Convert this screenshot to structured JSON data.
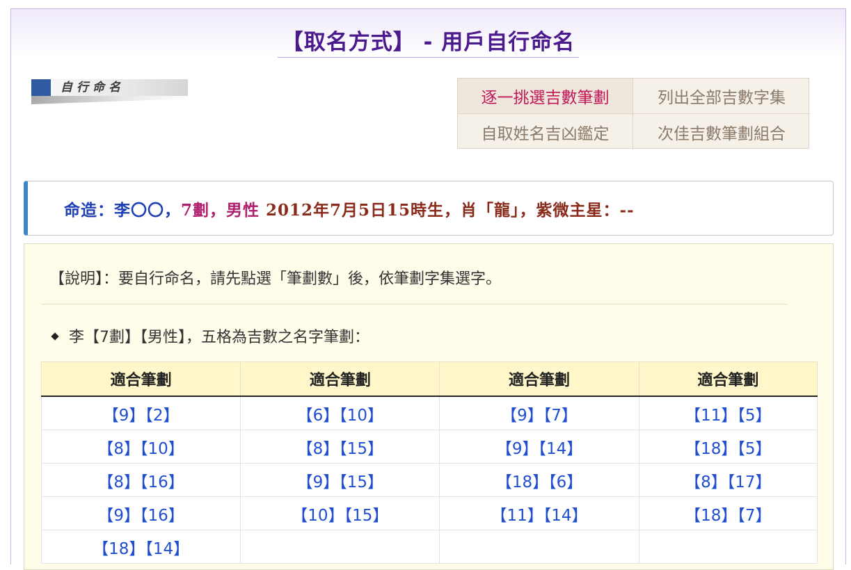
{
  "page": {
    "title": "【取名方式】 - 用戶自行命名"
  },
  "side_banner": {
    "label": "自行命名"
  },
  "tabs": [
    {
      "label": "逐一挑選吉數筆劃",
      "active": true
    },
    {
      "label": "列出全部吉數字集",
      "active": false
    },
    {
      "label": "自取姓名吉凶鑑定",
      "active": false
    },
    {
      "label": "次佳吉數筆劃組合",
      "active": false
    }
  ],
  "destiny": {
    "part1": "命造：李〇〇，",
    "part2": "7劃，男性",
    "part3": " 2012年7月5日15時生，肖「龍」，紫微主星：--"
  },
  "panel": {
    "description": "【說明】：要自行命名，請先點選「筆劃數」後，依筆劃字集選字。",
    "subtitle": "李【7劃】【男性】，五格為吉數之名字筆劃：",
    "column_headers": [
      "適合筆劃",
      "適合筆劃",
      "適合筆劃",
      "適合筆劃"
    ],
    "rows": [
      [
        "【9】【2】",
        "【6】【10】",
        "【9】【7】",
        "【11】【5】"
      ],
      [
        "【8】【10】",
        "【8】【15】",
        "【9】【14】",
        "【18】【5】"
      ],
      [
        "【8】【16】",
        "【9】【15】",
        "【18】【6】",
        "【8】【17】"
      ],
      [
        "【9】【16】",
        "【10】【15】",
        "【11】【14】",
        "【18】【7】"
      ],
      [
        "【18】【14】",
        "",
        "",
        ""
      ]
    ]
  },
  "colors": {
    "title": "#4b1a8c",
    "active_tab": "#c0185a",
    "link": "#1f4fd0",
    "accent_bar": "#3f84c8",
    "header_bg": "#fff7c9"
  }
}
